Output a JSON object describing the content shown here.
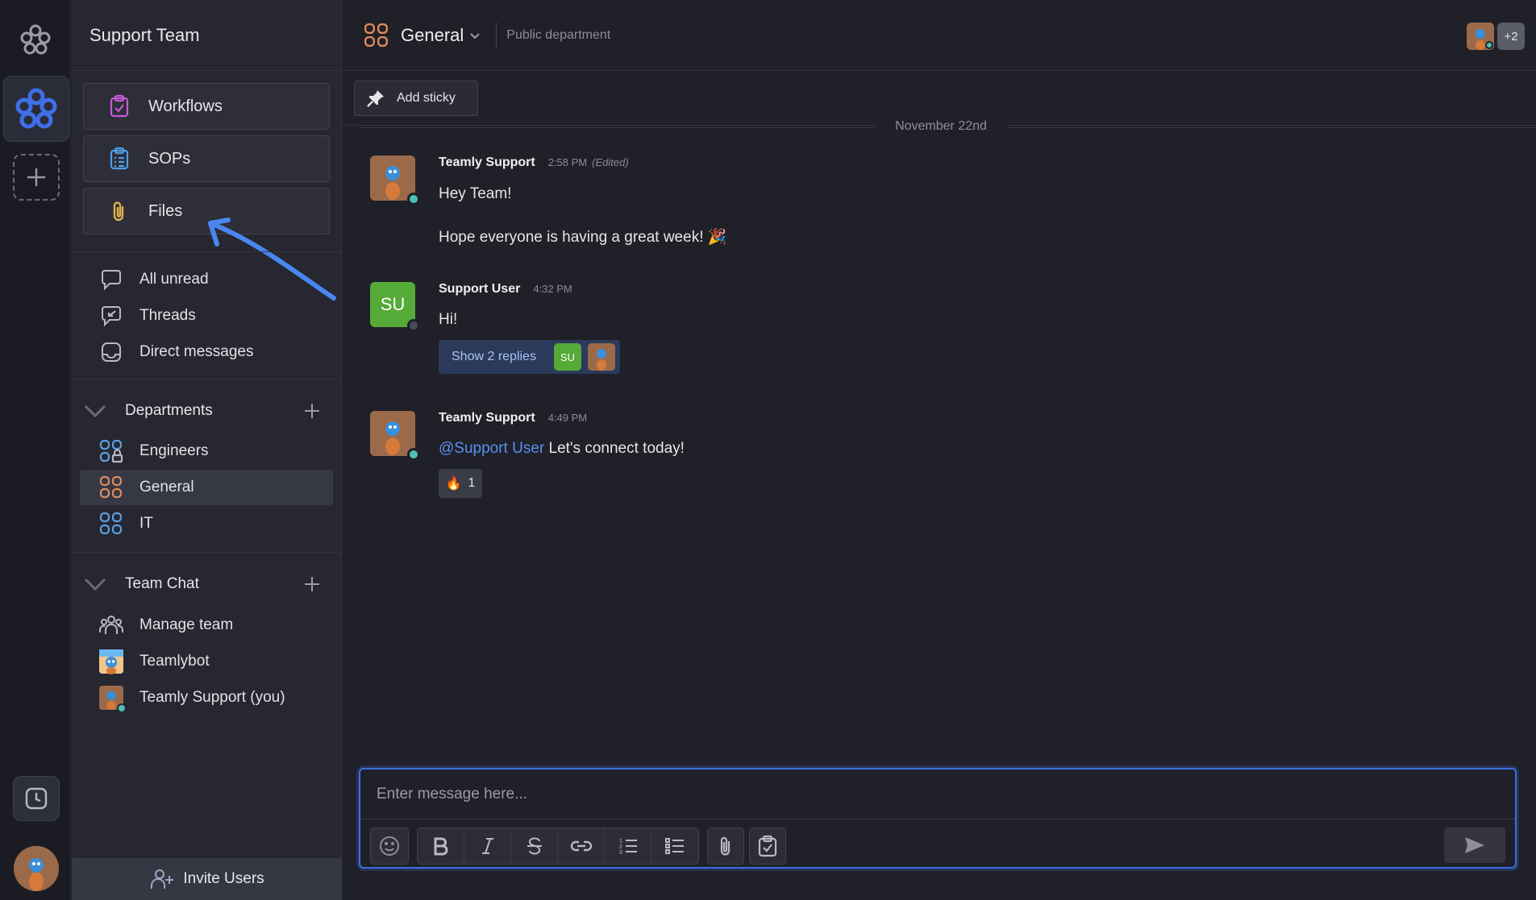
{
  "workspace": {
    "name": "Support Team"
  },
  "sidebar": {
    "cards": [
      {
        "label": "Workflows",
        "icon": "workflows-icon"
      },
      {
        "label": "SOPs",
        "icon": "sops-icon"
      },
      {
        "label": "Files",
        "icon": "paperclip-icon"
      }
    ],
    "quick": [
      {
        "label": "All unread",
        "icon": "chat-bubble-icon"
      },
      {
        "label": "Threads",
        "icon": "threads-icon"
      },
      {
        "label": "Direct messages",
        "icon": "inbox-icon"
      }
    ],
    "departments": {
      "title": "Departments",
      "items": [
        {
          "label": "Engineers",
          "icon": "locked-department-icon"
        },
        {
          "label": "General",
          "icon": "department-icon",
          "active": true
        },
        {
          "label": "IT",
          "icon": "department-icon"
        }
      ]
    },
    "team_chat": {
      "title": "Team Chat",
      "items": [
        {
          "label": "Manage team",
          "icon": "team-icon"
        },
        {
          "label": "Teamlybot",
          "icon": "bot-avatar"
        },
        {
          "label": "Teamly Support (you)",
          "icon": "user-avatar"
        }
      ]
    },
    "invite_label": "Invite Users"
  },
  "channel": {
    "name": "General",
    "description": "Public department",
    "extra_members": "+2"
  },
  "toolbar": {
    "sticky_label": "Add sticky"
  },
  "date_divider": "November 22nd",
  "messages": [
    {
      "author": "Teamly Support",
      "time": "2:58 PM",
      "edited": "(Edited)",
      "line1": "Hey Team!",
      "line2": "Hope everyone is having a great week! 🎉"
    },
    {
      "author": "Support User",
      "initials": "SU",
      "time": "4:32 PM",
      "text": "Hi!",
      "replies_label": "Show 2 replies",
      "reply_initials": "SU"
    },
    {
      "author": "Teamly Support",
      "time": "4:49 PM",
      "mention": "@Support User",
      "text": "Let's connect today!",
      "reaction_emoji": "🔥",
      "reaction_count": "1"
    }
  ],
  "composer": {
    "placeholder": "Enter message here..."
  },
  "colors": {
    "accent": "#3d6de0",
    "link": "#5a8ff0",
    "online": "#4fc1b6",
    "su_green": "#55aa38",
    "department_orange": "#e08a5a",
    "department_blue": "#5a9ee0"
  }
}
